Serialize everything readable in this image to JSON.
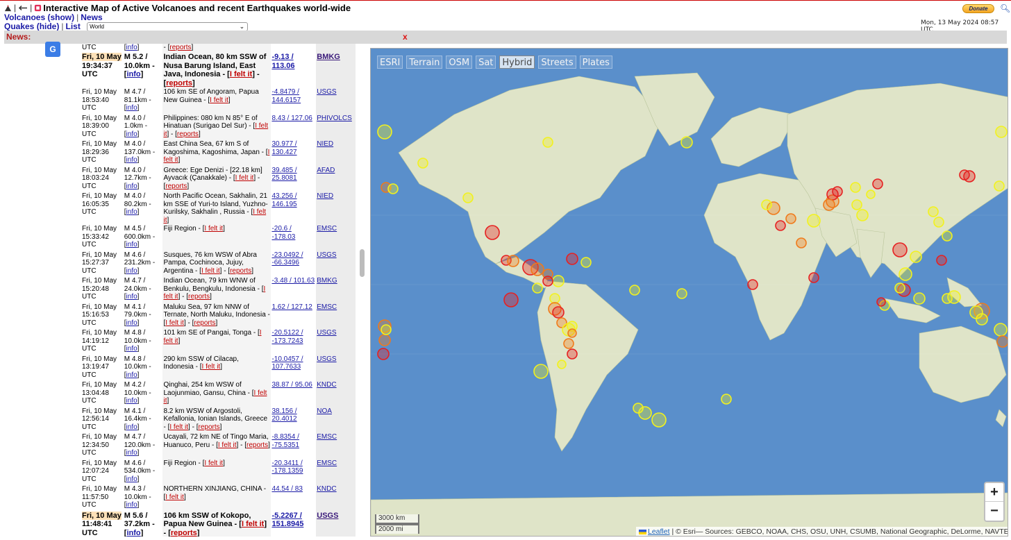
{
  "header": {
    "title": "Interactive Map of Active Volcanoes and recent Earthquakes world-wide",
    "nav1": {
      "volcanoes": "Volcanoes (show)",
      "news": "News"
    },
    "nav2": {
      "quakes": "Quakes (hide)",
      "list": "List",
      "region": "World"
    },
    "donate": "Donate",
    "datetime": "Mon, 13 May 2024 08:57 UTC",
    "pipe": "|",
    "sep": "|"
  },
  "news_bar": {
    "label": "News:",
    "close": "x"
  },
  "translate_icon": "G",
  "quakes": [
    {
      "date": "",
      "time": "UTC",
      "mag": "",
      "depth": "",
      "info": "info",
      "place": "",
      "felt": "",
      "reports": "reports",
      "coord1": "",
      "coord2": "",
      "source": "",
      "sliver": true
    },
    {
      "date": "Fri, 10 May",
      "time": "19:34:37 UTC",
      "mag": "M 5.2 /",
      "depth": "10.0km -",
      "info": "info",
      "place": "Indian Ocean, 80 km SSW of Nusa Barung Island, East Java, Indonesia - ",
      "felt": "I felt it",
      "reports": "reports",
      "coord1": "-9.13 /",
      "coord2": "113.06",
      "source": "BMKG",
      "big": true
    },
    {
      "date": "Fri, 10 May",
      "time": "18:53:40 UTC",
      "mag": "M 4.7 /",
      "depth": "81.1km -",
      "info": "info",
      "place": "106 km SE of Angoram, Papua New Guinea - ",
      "felt": "I felt it",
      "reports": "",
      "coord1": "-4.8479 /",
      "coord2": "144.6157",
      "source": "USGS"
    },
    {
      "date": "Fri, 10 May",
      "time": "18:39:00 UTC",
      "mag": "M 4.0 /",
      "depth": "1.0km -",
      "info": "info",
      "place": "Philippines: 080 km N 85° E of Hinatuan (Surigao Del Sur) - ",
      "felt": "I felt it",
      "reports": "reports",
      "coord1": "8.43 / 127.06",
      "coord2": "",
      "source": "PHIVOLCS"
    },
    {
      "date": "Fri, 10 May",
      "time": "18:29:36 UTC",
      "mag": "M 4.0 /",
      "depth": "137.0km -",
      "info": "info",
      "place": "East China Sea, 67 km S of Kagoshima, Kagoshima, Japan - ",
      "felt": "I felt it",
      "reports": "",
      "coord1": "30.977 /",
      "coord2": "130.427",
      "source": "NIED"
    },
    {
      "date": "Fri, 10 May",
      "time": "18:03:24 UTC",
      "mag": "M 4.0 /",
      "depth": "12.7km -",
      "info": "info",
      "place": "Greece: Ege Denizi - [22.18 km] Ayvacık (Çanakkale) - ",
      "felt": "I felt it",
      "reports": "reports",
      "coord1": "39.485 /",
      "coord2": "25.8081",
      "source": "AFAD"
    },
    {
      "date": "Fri, 10 May",
      "time": "16:05:35 UTC",
      "mag": "M 4.0 /",
      "depth": "80.2km -",
      "info": "info",
      "place": "North Pacific Ocean, Sakhalin, 21 km SSE of Yuri-to Island, Yuzhno-Kurilsky, Sakhalin , Russia - ",
      "felt": "I felt it",
      "reports": "",
      "coord1": "43.256 /",
      "coord2": "146.195",
      "source": "NIED"
    },
    {
      "date": "Fri, 10 May",
      "time": "15:33:42 UTC",
      "mag": "M 4.5 /",
      "depth": "600.0km -",
      "info": "info",
      "place": "Fiji Region - ",
      "felt": "I felt it",
      "reports": "",
      "coord1": "-20.6 /",
      "coord2": "-178.03",
      "source": "EMSC"
    },
    {
      "date": "Fri, 10 May",
      "time": "15:27:37 UTC",
      "mag": "M 4.6 /",
      "depth": "231.2km -",
      "info": "info",
      "place": "Susques, 76 km WSW of Abra Pampa, Cochinoca, Jujuy, Argentina - ",
      "felt": "I felt it",
      "reports": "reports",
      "coord1": "-23.0492 /",
      "coord2": "-66.3496",
      "source": "USGS"
    },
    {
      "date": "Fri, 10 May",
      "time": "15:20:48 UTC",
      "mag": "M 4.7 /",
      "depth": "24.0km -",
      "info": "info",
      "place": "Indian Ocean, 79 km WNW of Benkulu, Bengkulu, Indonesia - ",
      "felt": "I felt it",
      "reports": "reports",
      "coord1": "-3.48 / 101.63",
      "coord2": "",
      "source": "BMKG"
    },
    {
      "date": "Fri, 10 May",
      "time": "15:16:53 UTC",
      "mag": "M 4.1 /",
      "depth": "79.0km -",
      "info": "info",
      "place": "Maluku Sea, 97 km NNW of Ternate, North Maluku, Indonesia - ",
      "felt": "I felt it",
      "reports": "reports",
      "coord1": "1.62 / 127.12",
      "coord2": "",
      "source": "EMSC"
    },
    {
      "date": "Fri, 10 May",
      "time": "14:19:12 UTC",
      "mag": "M 4.8 /",
      "depth": "10.0km -",
      "info": "info",
      "place": "101 km SE of Pangai, Tonga - ",
      "felt": "I felt it",
      "reports": "",
      "coord1": "-20.5122 /",
      "coord2": "-173.7243",
      "source": "USGS"
    },
    {
      "date": "Fri, 10 May",
      "time": "13:19:47 UTC",
      "mag": "M 4.8 /",
      "depth": "10.0km -",
      "info": "info",
      "place": "290 km SSW of Cilacap, Indonesia - ",
      "felt": "I felt it",
      "reports": "",
      "coord1": "-10.0457 /",
      "coord2": "107.7633",
      "source": "USGS"
    },
    {
      "date": "Fri, 10 May",
      "time": "13:04:48 UTC",
      "mag": "M 4.2 /",
      "depth": "10.0km -",
      "info": "info",
      "place": "Qinghai, 254 km WSW of Laojunmiao, Gansu, China - ",
      "felt": "I felt it",
      "reports": "",
      "coord1": "38.87 / 95.06",
      "coord2": "",
      "source": "KNDC"
    },
    {
      "date": "Fri, 10 May",
      "time": "12:56:14 UTC",
      "mag": "M 4.1 /",
      "depth": "16.4km -",
      "info": "info",
      "place": "8.2 km WSW of Argostoli, Kefallonia, Ionian Islands, Greece - ",
      "felt": "I felt it",
      "reports": "reports",
      "coord1": "38.156 /",
      "coord2": "20.4012",
      "source": "NOA"
    },
    {
      "date": "Fri, 10 May",
      "time": "12:34:50 UTC",
      "mag": "M 4.7 /",
      "depth": "120.0km -",
      "info": "info",
      "place": "Ucayali, 72 km NE of Tingo Maria, Huanuco, Peru - ",
      "felt": "I felt it",
      "reports": "reports",
      "coord1": "-8.8354 /",
      "coord2": "-75.5351",
      "source": "EMSC"
    },
    {
      "date": "Fri, 10 May",
      "time": "12:07:24 UTC",
      "mag": "M 4.6 /",
      "depth": "534.0km -",
      "info": "info",
      "place": "Fiji Region - ",
      "felt": "I felt it",
      "reports": "",
      "coord1": "-20.3411 /",
      "coord2": "-178.1359",
      "source": "EMSC"
    },
    {
      "date": "Fri, 10 May",
      "time": "11:57:50 UTC",
      "mag": "M 4.3 /",
      "depth": "10.0km -",
      "info": "info",
      "place": "NORTHERN XINJIANG, CHINA - ",
      "felt": "I felt it",
      "reports": "",
      "coord1": "44.54 / 83",
      "coord2": "",
      "source": "KNDC"
    },
    {
      "date": "Fri, 10 May",
      "time": "11:48:41 UTC",
      "mag": "M 5.6 /",
      "depth": "37.2km -",
      "info": "info",
      "place": "106 km SSW of Kokopo, Papua New Guinea - ",
      "felt": "I felt it",
      "reports": "reports",
      "coord1": "-5.2267 /",
      "coord2": "151.8945",
      "source": "USGS",
      "big": true
    }
  ],
  "map": {
    "layers": [
      {
        "label": "ESRI",
        "active": false
      },
      {
        "label": "Terrain",
        "active": false
      },
      {
        "label": "OSM",
        "active": false
      },
      {
        "label": "Sat",
        "active": false
      },
      {
        "label": "Hybrid",
        "active": true
      },
      {
        "label": "Streets",
        "active": false
      },
      {
        "label": "Plates",
        "active": false
      }
    ],
    "zoom_in": "+",
    "zoom_out": "−",
    "scale_km": "3000 km",
    "scale_mi": "2000 mi",
    "attribution_leaflet": "Leaflet",
    "attribution_text": "| © Esri— Sources: GEBCO, NOAA, CHS, OSU, UNH, CSUMB, National Geographic, DeLorme, NAVTEQ, and Esri",
    "colors": {
      "ocean": "#4f86c2",
      "land": "#dbe2c3",
      "quake_red": "#e62020",
      "quake_orange": "#f07a1a",
      "quake_yellow": "#f2f21e"
    }
  }
}
